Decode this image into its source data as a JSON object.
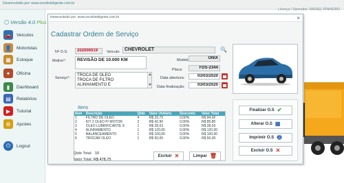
{
  "app": {
    "developer": "Desenvolvido por: www.excelinteligente.com.br",
    "license": "Licença / Operador: RAFAEL PINHEIRO",
    "version": "Versão 4.0",
    "edition": "Plus"
  },
  "sidebar": {
    "items": [
      {
        "label": "Veículos",
        "icon": "car-icon",
        "color": "#2f6fb0"
      },
      {
        "label": "Motoristas",
        "icon": "driver-icon",
        "color": "#d08a3a"
      },
      {
        "label": "Estoque",
        "icon": "box-icon",
        "color": "#c98c2d"
      },
      {
        "label": "Oficina",
        "icon": "wrench-icon",
        "color": "#b14b2c"
      },
      {
        "label": "Dashboard",
        "icon": "chart-icon",
        "color": "#3c8a4a"
      },
      {
        "label": "Relatórios",
        "icon": "report-icon",
        "color": "#3a66b5"
      },
      {
        "label": "Tutorial",
        "icon": "youtube-icon",
        "color": "#d12020"
      },
      {
        "label": "Ajustes",
        "icon": "gear-icon",
        "color": "#d4a012"
      },
      {
        "label": "Logout",
        "icon": "logout-icon",
        "color": "#2a6bb3"
      }
    ]
  },
  "dialog": {
    "developer": "Desenvolvido por: www.excelinteligente.com.br",
    "close": "×",
    "title": "Cadastrar Ordem de Serviço",
    "os_label": "Nº O.S:",
    "os_value": "202000019",
    "vehicle_label": "Veículo:",
    "vehicle_value": "CHEVROLET",
    "reason_label": "Motivo*:",
    "reason_value": "REVISÃO DE 10.000 KM",
    "model_label": "Modelo:",
    "model_value": "ONIX",
    "plate_label": "Placa:",
    "plate_value": "FDS-2344",
    "open_date_label": "Data abertura:",
    "open_date_value": "03/03/2020",
    "close_date_label": "Data finalização:",
    "close_date_value": "03/03/2020",
    "services_label": "Serviço*:",
    "services": [
      "TROCA DE ÓLEO",
      "TROCA DE FILTRO",
      "ALINHAMENTO E"
    ],
    "items_label": "Itens",
    "table": {
      "columns": [
        "Item",
        "Descrição",
        "Qtde",
        "Valor Unitário",
        "Desconto",
        "Valor Total"
      ],
      "rows": [
        [
          "1",
          "FILTRO DE ÓLEO",
          "4",
          "R$ 23,73",
          "0,00%",
          "R$ 94,92"
        ],
        [
          "2",
          "KIT 2 ÓLEO P/ MOTOR",
          "2",
          "R$ 42,90",
          "0,00%",
          "R$ 85,80"
        ],
        [
          "3",
          "ÓLEO LUBRIFICANTE S",
          "1",
          "R$ 28,03",
          "0,00%",
          "R$ 28,03"
        ],
        [
          "4",
          "ALINHAMENTO",
          "1",
          "R$ 120,00",
          "0,00%",
          "R$ 120,00"
        ],
        [
          "5",
          "BALANCEAMENTO",
          "1",
          "R$ 100,00",
          "0,00%",
          "R$ 100,00"
        ],
        [
          "6",
          "TROCAR ÓLEO",
          "1",
          "R$ 50,00",
          "0,00%",
          "R$ 50,00"
        ]
      ]
    },
    "qty_total_label": "Qtde Total:",
    "qty_total_value": "10",
    "value_total_label": "Valor Total:",
    "value_total_value": "R$ 478,75",
    "buttons": {
      "delete": "Excluir",
      "clear": "Limpar",
      "finalize": "Finalizar O.S",
      "edit": "Alterar O.S",
      "print": "Imprimir O.S",
      "delete_os": "Excluir O.S"
    }
  }
}
